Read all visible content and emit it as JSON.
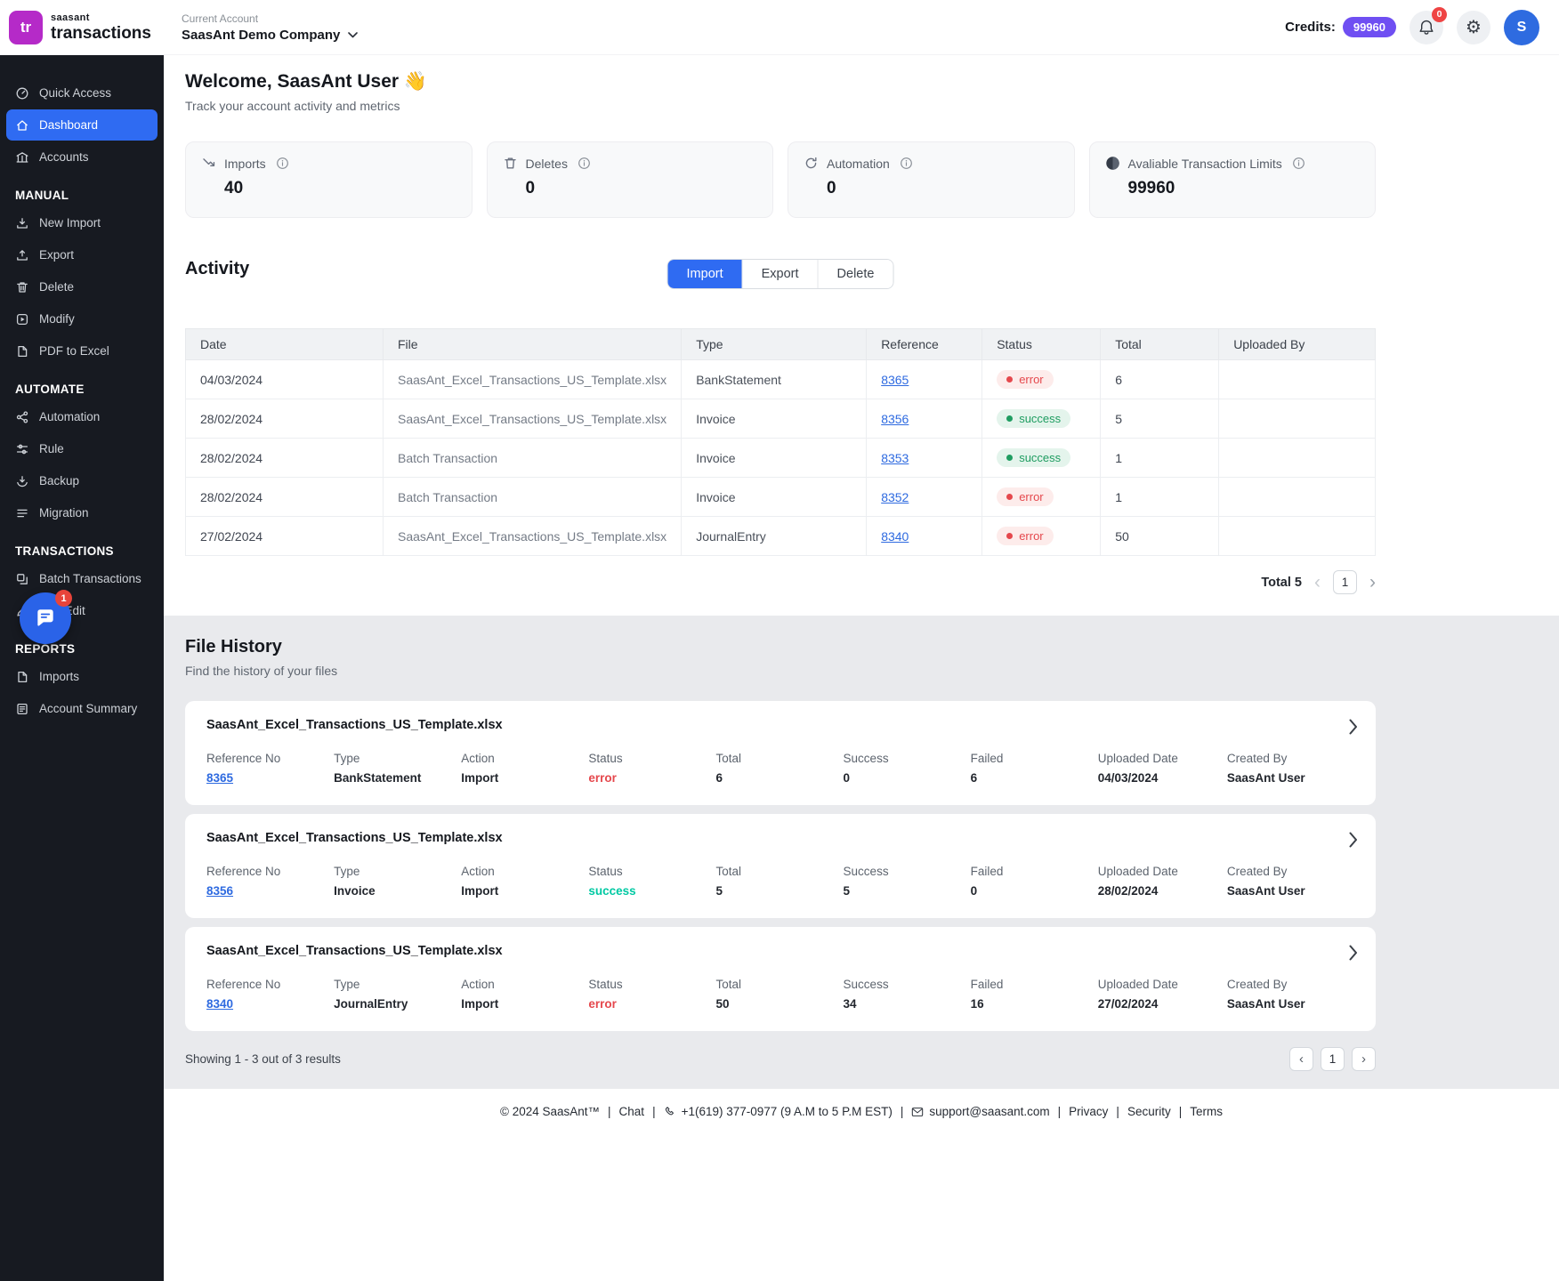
{
  "colors": {
    "accent_blue": "#2f6bf2",
    "brand_magenta": "#b52ac8",
    "credits_badge_purple": "#6f4ff2",
    "sidebar_bg": "#171a21",
    "error_red": "#e5484d",
    "success_green": "#1f9d61",
    "success_teal": "#00c9a3",
    "link_blue": "#2e6ae0"
  },
  "header": {
    "logo_mark": "tr",
    "logo_top": "saasant",
    "logo_bottom": "transactions",
    "account_label": "Current Account",
    "account_name": "SaasAnt Demo Company",
    "credits_label": "Credits:",
    "credits_value": "99960",
    "bell_badge": "0",
    "avatar": "S"
  },
  "sidebar": {
    "top_items": [
      {
        "label": "Quick Access"
      },
      {
        "label": "Dashboard"
      },
      {
        "label": "Accounts"
      }
    ],
    "sections": [
      {
        "title": "MANUAL",
        "items": [
          {
            "label": "New Import"
          },
          {
            "label": "Export"
          },
          {
            "label": "Delete"
          },
          {
            "label": "Modify"
          },
          {
            "label": "PDF to Excel"
          }
        ]
      },
      {
        "title": "AUTOMATE",
        "items": [
          {
            "label": "Automation"
          },
          {
            "label": "Rule"
          },
          {
            "label": "Backup"
          },
          {
            "label": "Migration"
          }
        ]
      },
      {
        "title": "TRANSACTIONS",
        "items": [
          {
            "label": "Batch Transactions"
          },
          {
            "label": "Live Edit"
          }
        ]
      },
      {
        "title": "REPORTS",
        "items": [
          {
            "label": "Imports"
          },
          {
            "label": "Account Summary"
          }
        ]
      }
    ],
    "chat_badge": "1"
  },
  "welcome": {
    "title": "Welcome, SaasAnt User 👋",
    "subtitle": "Track your account activity and metrics"
  },
  "metrics": [
    {
      "label": "Imports",
      "value": "40"
    },
    {
      "label": "Deletes",
      "value": "0"
    },
    {
      "label": "Automation",
      "value": "0"
    },
    {
      "label": "Avaliable Transaction Limits",
      "value": "99960"
    }
  ],
  "activity": {
    "title": "Activity",
    "tabs": [
      {
        "label": "Import"
      },
      {
        "label": "Export"
      },
      {
        "label": "Delete"
      }
    ],
    "columns": [
      "Date",
      "File",
      "Type",
      "Reference",
      "Status",
      "Total",
      "Uploaded By"
    ],
    "rows": [
      {
        "date": "04/03/2024",
        "file": "SaasAnt_Excel_Transactions_US_Template.xlsx",
        "type": "BankStatement",
        "reference": "8365",
        "status": "error",
        "total": "6",
        "uploaded_by": ""
      },
      {
        "date": "28/02/2024",
        "file": "SaasAnt_Excel_Transactions_US_Template.xlsx",
        "type": "Invoice",
        "reference": "8356",
        "status": "success",
        "total": "5",
        "uploaded_by": ""
      },
      {
        "date": "28/02/2024",
        "file": "Batch Transaction",
        "type": "Invoice",
        "reference": "8353",
        "status": "success",
        "total": "1",
        "uploaded_by": ""
      },
      {
        "date": "28/02/2024",
        "file": "Batch Transaction",
        "type": "Invoice",
        "reference": "8352",
        "status": "error",
        "total": "1",
        "uploaded_by": ""
      },
      {
        "date": "27/02/2024",
        "file": "SaasAnt_Excel_Transactions_US_Template.xlsx",
        "type": "JournalEntry",
        "reference": "8340",
        "status": "error",
        "total": "50",
        "uploaded_by": ""
      }
    ],
    "total_label": "Total 5",
    "prev": "‹",
    "next": "›",
    "page": "1"
  },
  "file_history": {
    "title": "File History",
    "subtitle": "Find the history of your files",
    "labels": {
      "reference": "Reference No",
      "type": "Type",
      "action": "Action",
      "status": "Status",
      "total": "Total",
      "success": "Success",
      "failed": "Failed",
      "uploaded_date": "Uploaded Date",
      "created_by": "Created By"
    },
    "cards": [
      {
        "file": "SaasAnt_Excel_Transactions_US_Template.xlsx",
        "reference": "8365",
        "type": "BankStatement",
        "action": "Import",
        "status": "error",
        "total": "6",
        "success": "0",
        "failed": "6",
        "uploaded_date": "04/03/2024",
        "created_by": "SaasAnt User"
      },
      {
        "file": "SaasAnt_Excel_Transactions_US_Template.xlsx",
        "reference": "8356",
        "type": "Invoice",
        "action": "Import",
        "status": "success",
        "total": "5",
        "success": "5",
        "failed": "0",
        "uploaded_date": "28/02/2024",
        "created_by": "SaasAnt User"
      },
      {
        "file": "SaasAnt_Excel_Transactions_US_Template.xlsx",
        "reference": "8340",
        "type": "JournalEntry",
        "action": "Import",
        "status": "error",
        "total": "50",
        "success": "34",
        "failed": "16",
        "uploaded_date": "27/02/2024",
        "created_by": "SaasAnt User"
      }
    ],
    "showing": "Showing 1 - 3 out of 3 results",
    "prev": "‹",
    "next": "›",
    "page": "1"
  },
  "footer": {
    "copyright": "© 2024 SaasAnt™",
    "chat": "Chat",
    "phone": "+1(619) 377-0977 (9 A.M to 5 P.M EST)",
    "email": "support@saasant.com",
    "privacy": "Privacy",
    "security": "Security",
    "terms": "Terms",
    "separator": "|"
  }
}
